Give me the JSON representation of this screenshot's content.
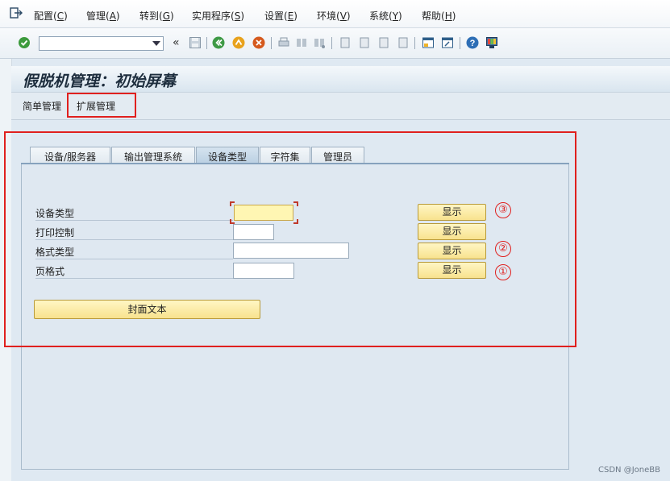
{
  "menubar": {
    "items": [
      {
        "label": "配置(",
        "key": "C",
        "tail": ")"
      },
      {
        "label": "管理(",
        "key": "A",
        "tail": ")"
      },
      {
        "label": "转到(",
        "key": "G",
        "tail": ")"
      },
      {
        "label": "实用程序(",
        "key": "S",
        "tail": ")"
      },
      {
        "label": "设置(",
        "key": "E",
        "tail": ")"
      },
      {
        "label": "环境(",
        "key": "V",
        "tail": ")"
      },
      {
        "label": "系统(",
        "key": "Y",
        "tail": ")"
      },
      {
        "label": "帮助(",
        "key": "H",
        "tail": ")"
      }
    ]
  },
  "toolbar": {
    "command_value": "",
    "back_label": "«"
  },
  "page": {
    "title": "假脱机管理：初始屏幕"
  },
  "app_toolbar": {
    "simple": "简单管理",
    "extended": "扩展管理"
  },
  "tabs": [
    {
      "label": "设备/服务器"
    },
    {
      "label": "输出管理系统"
    },
    {
      "label": "设备类型"
    },
    {
      "label": "字符集"
    },
    {
      "label": "管理员"
    }
  ],
  "form": {
    "rows": [
      {
        "label": "设备类型",
        "value": "",
        "button": "显示",
        "annotation": "③"
      },
      {
        "label": "打印控制",
        "value": "",
        "button": "显示",
        "annotation": ""
      },
      {
        "label": "格式类型",
        "value": "",
        "button": "显示",
        "annotation": "②"
      },
      {
        "label": "页格式",
        "value": "",
        "button": "显示",
        "annotation": "①"
      }
    ],
    "cover_button": "封面文本"
  },
  "watermark": "CSDN @JoneBB",
  "colors": {
    "button": "#f8e28e",
    "annotation_red": "#e0201e",
    "active_tab": "#b9cfe2"
  }
}
